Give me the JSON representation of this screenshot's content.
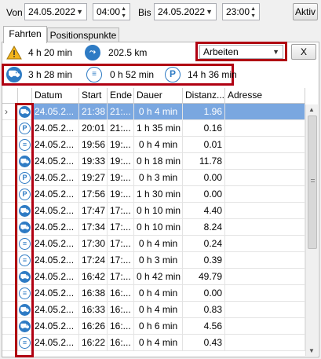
{
  "toolbar": {
    "from_label": "Von",
    "from_date": "24.05.2022",
    "from_time": "04:00",
    "to_label": "Bis",
    "to_date": "24.05.2022",
    "to_time": "23:00",
    "activate_label": "Aktiv"
  },
  "tabs": [
    {
      "label": "Fahrten",
      "active": true
    },
    {
      "label": "Positionspunkte",
      "active": false
    }
  ],
  "summary": {
    "warning_duration": "4 h 20 min",
    "distance": "202.5 km",
    "category_value": "Arbeiten",
    "clear_label": "X",
    "drive_duration": "3 h 28 min",
    "idle_duration": "0 h 52 min",
    "park_duration": "14 h 36 min",
    "icons": {
      "warning": "warning-icon",
      "distance": "route-icon",
      "drive": "car-icon",
      "idle": "idle-icon",
      "park": "parking-icon"
    }
  },
  "table": {
    "columns": [
      "Datum",
      "Start",
      "Ende",
      "Dauer",
      "Distanz...",
      "Adresse"
    ],
    "rows": [
      {
        "type": "drive",
        "date": "24.05.2...",
        "start": "21:38",
        "end": "21:...",
        "duration": "0 h 4 min",
        "distance": "1.96",
        "address": "",
        "selected": true
      },
      {
        "type": "park",
        "date": "24.05.2...",
        "start": "20:01",
        "end": "21:...",
        "duration": "1 h 35 min",
        "distance": "0.16",
        "address": ""
      },
      {
        "type": "idle",
        "date": "24.05.2...",
        "start": "19:56",
        "end": "19:...",
        "duration": "0 h 4 min",
        "distance": "0.01",
        "address": ""
      },
      {
        "type": "drive",
        "date": "24.05.2...",
        "start": "19:33",
        "end": "19:...",
        "duration": "0 h 18 min",
        "distance": "11.78",
        "address": ""
      },
      {
        "type": "park",
        "date": "24.05.2...",
        "start": "19:27",
        "end": "19:...",
        "duration": "0 h 3 min",
        "distance": "0.00",
        "address": ""
      },
      {
        "type": "park",
        "date": "24.05.2...",
        "start": "17:56",
        "start2": "",
        "end": "19:...",
        "duration": "1 h 30 min",
        "distance": "0.00",
        "address": ""
      },
      {
        "type": "drive",
        "date": "24.05.2...",
        "start": "17:47",
        "end": "17:...",
        "duration": "0 h 10 min",
        "distance": "4.40",
        "address": ""
      },
      {
        "type": "drive",
        "date": "24.05.2...",
        "start": "17:34",
        "end": "17:...",
        "duration": "0 h 10 min",
        "distance": "8.24",
        "address": ""
      },
      {
        "type": "idle",
        "date": "24.05.2...",
        "start": "17:30",
        "end": "17:...",
        "duration": "0 h 4 min",
        "distance": "0.24",
        "address": ""
      },
      {
        "type": "idle",
        "date": "24.05.2...",
        "start": "17:24",
        "end": "17:...",
        "duration": "0 h 3 min",
        "distance": "0.39",
        "address": ""
      },
      {
        "type": "drive",
        "date": "24.05.2...",
        "start": "16:42",
        "end": "17:...",
        "duration": "0 h 42 min",
        "distance": "49.79",
        "address": ""
      },
      {
        "type": "idle",
        "date": "24.05.2...",
        "start": "16:38",
        "end": "16:...",
        "duration": "0 h 4 min",
        "distance": "0.00",
        "address": ""
      },
      {
        "type": "drive",
        "date": "24.05.2...",
        "start": "16:33",
        "end": "16:...",
        "duration": "0 h 4 min",
        "distance": "0.83",
        "address": ""
      },
      {
        "type": "drive",
        "date": "24.05.2...",
        "start": "16:26",
        "end": "16:...",
        "duration": "0 h 6 min",
        "distance": "4.56",
        "address": ""
      },
      {
        "type": "idle",
        "date": "24.05.2...",
        "start": "16:22",
        "end": "16:...",
        "duration": "0 h 4 min",
        "distance": "0.43",
        "address": ""
      }
    ]
  },
  "colors": {
    "accent": "#2e7bc4",
    "highlight": "#b00012",
    "selection": "#7aa7e0"
  }
}
